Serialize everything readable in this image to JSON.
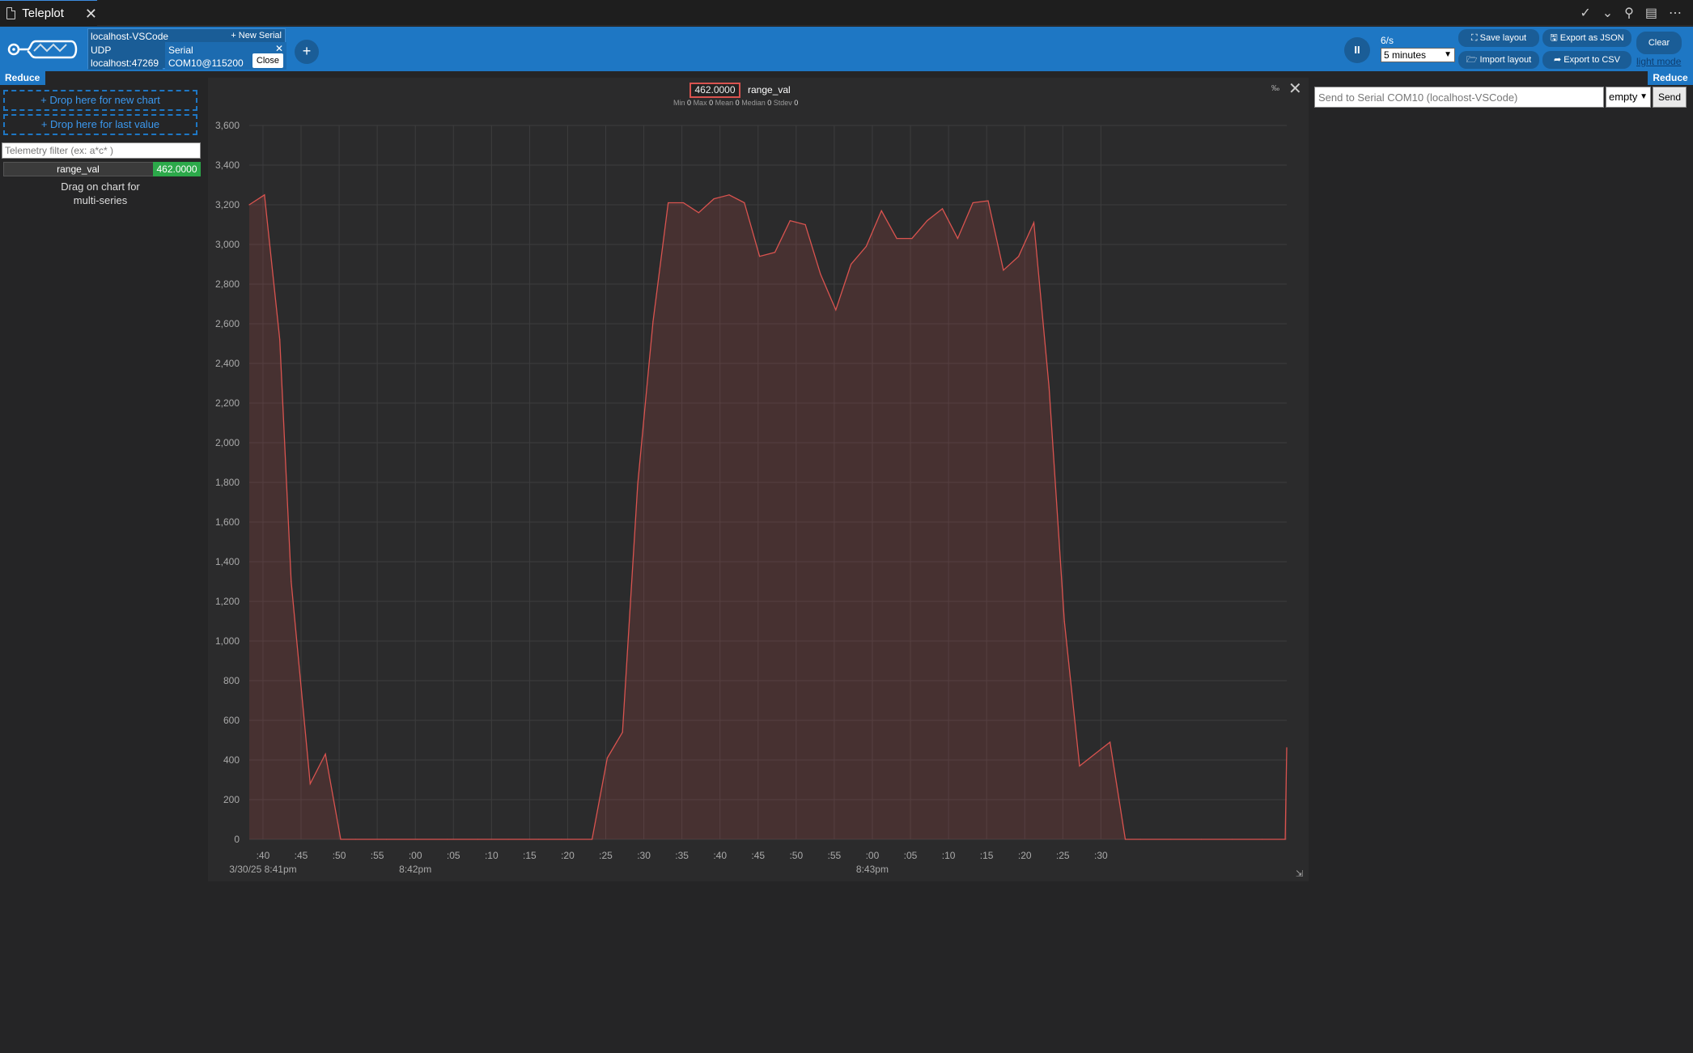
{
  "tab": {
    "title": "Teleplot",
    "close": "✕"
  },
  "tab_actions": {
    "check": "✓",
    "chev": "⌄",
    "debug": "⚲",
    "layout": "▤",
    "more": "⋯"
  },
  "header": {
    "connection_name": "localhost-VSCode",
    "new_serial": "+ New Serial",
    "udp_label": "UDP",
    "udp_address": "localhost:47269",
    "serial_label": "Serial",
    "serial_port": "COM10@115200",
    "serial_x": "✕",
    "close_label": "Close",
    "add_connection": "+",
    "pause_icon": "II",
    "rate": "6/s",
    "window": "5 minutes",
    "save_layout": "⛶ Save layout",
    "import_layout": "🗁 Import layout",
    "export_json": "🖫 Export as JSON",
    "export_csv": "➦ Export to CSV",
    "clear": "Clear",
    "light_mode": "light mode"
  },
  "sidebar": {
    "reduce": "Reduce",
    "drop_new_chart": "+ Drop here for new chart",
    "drop_last_value": "+ Drop here for last value",
    "filter_placeholder": "Telemetry filter (ex: a*c* )",
    "telemetry_name": "range_val",
    "telemetry_value": "462.0000",
    "drag_hint_1": "Drag on chart for",
    "drag_hint_2": "multi-series"
  },
  "chart": {
    "legend_value": "462.0000",
    "legend_name": "range_val",
    "stats": {
      "min_label": "Min",
      "min": "0",
      "max_label": "Max",
      "max": "0",
      "mean_label": "Mean",
      "mean": "0",
      "median_label": "Median",
      "median": "0",
      "stdev_label": "Stdev",
      "stdev": "0"
    },
    "reset_zoom": "‰",
    "close": "✕",
    "resize": "⇲"
  },
  "chart_data": {
    "type": "area",
    "series": [
      {
        "name": "range_val",
        "color": "#d9534f",
        "x": [
          0,
          2,
          4,
          5.5,
          8,
          10,
          12,
          14,
          18,
          22,
          26,
          30,
          34,
          38,
          41,
          45,
          47,
          49,
          51,
          53,
          55,
          57,
          59,
          61,
          63,
          65,
          67,
          69,
          71,
          73,
          75,
          77,
          79,
          81,
          83,
          85,
          87,
          89,
          91,
          93,
          95,
          97,
          99,
          101,
          103,
          105,
          107,
          109,
          111,
          113,
          115,
          117,
          121,
          125,
          129,
          133,
          136,
          136.2
        ],
        "values": [
          3200,
          3250,
          2520,
          1300,
          280,
          430,
          0,
          0,
          0,
          0,
          0,
          0,
          0,
          0,
          0,
          0,
          410,
          540,
          1790,
          2610,
          3210,
          3210,
          3160,
          3230,
          3250,
          3210,
          2940,
          2960,
          3120,
          3100,
          2850,
          2670,
          2900,
          2990,
          3170,
          3030,
          3030,
          3120,
          3180,
          3030,
          3210,
          3220,
          2870,
          2940,
          3110,
          2280,
          1100,
          370,
          430,
          490,
          0,
          0,
          0,
          0,
          0,
          0,
          0,
          462
        ]
      }
    ],
    "x_tick_labels": [
      ":40",
      ":45",
      ":50",
      ":55",
      ":00",
      ":05",
      ":10",
      ":15",
      ":20",
      ":25",
      ":30",
      ":35",
      ":40",
      ":45",
      ":50",
      ":55",
      ":00",
      ":05",
      ":10",
      ":15",
      ":20",
      ":25",
      ":30"
    ],
    "x_date_labels": [
      {
        "label": "3/30/25 8:41pm",
        "at": 0
      },
      {
        "label": "8:42pm",
        "at": 4
      },
      {
        "label": "8:43pm",
        "at": 16
      }
    ],
    "y_ticks": [
      0,
      200,
      400,
      600,
      800,
      1000,
      1200,
      1400,
      1600,
      1800,
      2000,
      2200,
      2400,
      2600,
      2800,
      3000,
      3200,
      3400,
      3600
    ],
    "y_tick_labels": [
      "0",
      "200",
      "400",
      "600",
      "800",
      "1,000",
      "1,200",
      "1,400",
      "1,600",
      "1,800",
      "2,000",
      "2,200",
      "2,400",
      "2,600",
      "2,800",
      "3,000",
      "3,200",
      "3,400",
      "3,600"
    ],
    "ylim": [
      0,
      3600
    ],
    "grid": true,
    "legend": "top-center"
  },
  "serial_send": {
    "reduce": "Reduce",
    "placeholder": "Send to Serial COM10 (localhost-VSCode)",
    "line_ending": "empty",
    "send": "Send"
  }
}
